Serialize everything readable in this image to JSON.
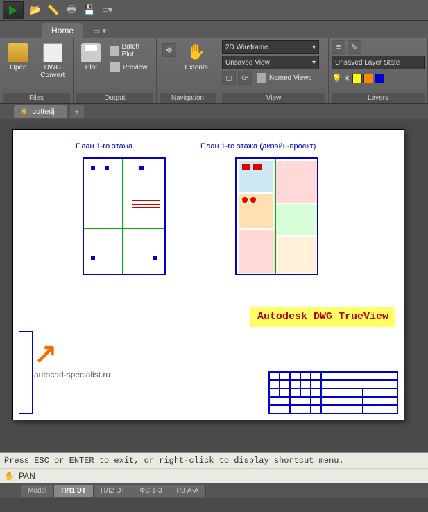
{
  "qat": {
    "icons": [
      "folder-open-icon",
      "ruler-icon",
      "print-icon",
      "save-icon",
      "layers-icon"
    ]
  },
  "tabs": {
    "home": "Home"
  },
  "ribbon": {
    "files": {
      "title": "Files",
      "open": "Open",
      "convert": "DWG\nConvert"
    },
    "output": {
      "title": "Output",
      "plot": "Plot",
      "batch": "Batch Plot",
      "preview": "Preview"
    },
    "navigation": {
      "title": "Navigation",
      "extents": "Extents"
    },
    "view": {
      "title": "View",
      "style": "2D Wireframe",
      "saved": "Unsaved View",
      "named": "Named Views"
    },
    "layers": {
      "title": "Layers",
      "state": "Unsaved Layer State"
    }
  },
  "doc": {
    "name": "cottedj"
  },
  "drawing": {
    "title1": "План 1-го этажа",
    "title2": "План 1-го этажа (дизайн-проект)",
    "watermark": "Autodesk DWG TrueView",
    "site": "autocad-specialist.ru"
  },
  "command": {
    "hint": "Press ESC or ENTER to exit, or right-click to display shortcut menu.",
    "current": "PAN"
  },
  "layouts": {
    "items": [
      "Model",
      "ПЛ1 ЭТ",
      "ПЛ2 ЭТ",
      "ФС 1-3",
      "РЗ А-А"
    ],
    "active": 1
  }
}
